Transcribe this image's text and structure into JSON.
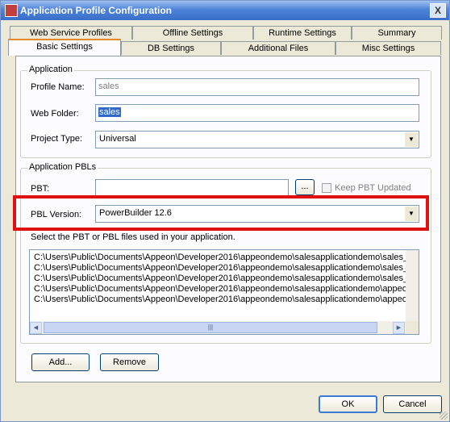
{
  "window": {
    "title": "Application Profile Configuration",
    "close_label": "X"
  },
  "tabs_row1": [
    "Web Service Profiles",
    "Offline Settings",
    "Runtime Settings",
    "Summary"
  ],
  "tabs_row2": [
    "Basic Settings",
    "DB Settings",
    "Additional Files",
    "Misc Settings"
  ],
  "application": {
    "group_label": "Application",
    "profile_name_label": "Profile Name:",
    "profile_name_value": "sales",
    "web_folder_label": "Web Folder:",
    "web_folder_value": "sales",
    "project_type_label": "Project Type:",
    "project_type_value": "Universal"
  },
  "pbls": {
    "group_label": "Application PBLs",
    "pbt_label": "PBT:",
    "pbt_value": "",
    "browse_label": "...",
    "keep_pbt_label": "Keep PBT Updated",
    "pbl_version_label": "PBL Version:",
    "pbl_version_value": "PowerBuilder 12.6",
    "instruction": "Select the PBT or PBL files used in your application.",
    "files": [
      "C:\\Users\\Public\\Documents\\Appeon\\Developer2016\\appeondemo\\salesapplicationdemo\\sales_",
      "C:\\Users\\Public\\Documents\\Appeon\\Developer2016\\appeondemo\\salesapplicationdemo\\sales_",
      "C:\\Users\\Public\\Documents\\Appeon\\Developer2016\\appeondemo\\salesapplicationdemo\\sales_",
      "C:\\Users\\Public\\Documents\\Appeon\\Developer2016\\appeondemo\\salesapplicationdemo\\appeo",
      "C:\\Users\\Public\\Documents\\Appeon\\Developer2016\\appeondemo\\salesapplicationdemo\\appeo"
    ]
  },
  "buttons": {
    "add": "Add...",
    "remove": "Remove",
    "ok": "OK",
    "cancel": "Cancel"
  },
  "colors": {
    "highlight_box": "#e01010",
    "selection": "#316ac5",
    "active_tab_accent": "#e68b2c"
  }
}
